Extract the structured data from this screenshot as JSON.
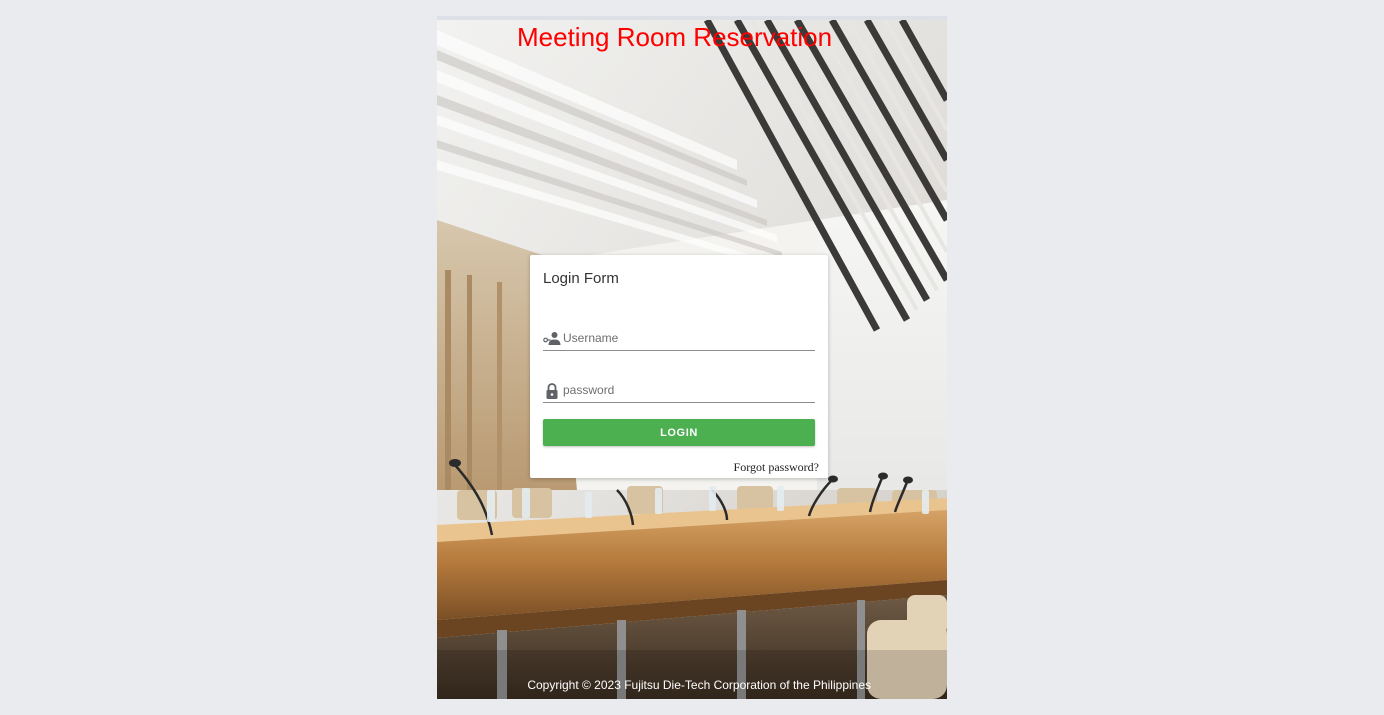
{
  "header": {
    "title": "Meeting Room Reservation",
    "title_color": "#ff0000"
  },
  "background": {
    "description_icon": "conference-room-photo"
  },
  "login_form": {
    "title": "Login Form",
    "username": {
      "icon": "user-key-icon",
      "placeholder": "Username",
      "value": ""
    },
    "password": {
      "icon": "lock-icon",
      "placeholder": "password",
      "value": ""
    },
    "login_label": "LOGIN",
    "login_color": "#4caf50",
    "forgot_label": "Forgot password?"
  },
  "footer": {
    "copyright": "Copyright © 2023 Fujitsu Die-Tech Corporation of the Philippines"
  }
}
